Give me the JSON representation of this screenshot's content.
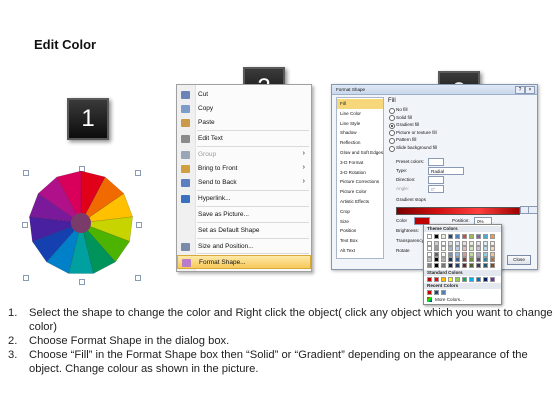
{
  "title": "Edit Color",
  "badges": [
    "1",
    "2",
    "3"
  ],
  "wheel": {
    "colors": [
      "#e0001a",
      "#f06a00",
      "#ffc000",
      "#c8d400",
      "#4cb400",
      "#00935a",
      "#00a0a0",
      "#0080c8",
      "#1440b0",
      "#4820a0",
      "#7a1a9a",
      "#b0108a",
      "#d8005a"
    ]
  },
  "context_menu": {
    "items": [
      {
        "label": "Cut",
        "icon": "scissors-icon",
        "color": "#6a84b8"
      },
      {
        "label": "Copy",
        "icon": "copy-icon",
        "color": "#7f9cc8"
      },
      {
        "label": "Paste",
        "icon": "paste-icon",
        "color": "#c89a4a"
      },
      {
        "label": "Edit Text",
        "icon": "edit-text-icon",
        "color": "#8a8a8a"
      },
      {
        "label": "Group",
        "icon": "group-icon",
        "color": "#9aa6b8"
      },
      {
        "label": "Bring to Front",
        "icon": "bring-to-front-icon",
        "color": "#d0a040"
      },
      {
        "label": "Send to Back",
        "icon": "send-to-back-icon",
        "color": "#5d7fc0"
      },
      {
        "label": "Hyperlink...",
        "icon": "hyperlink-icon",
        "color": "#3a70c0"
      },
      {
        "label": "Save as Picture...",
        "icon": "",
        "color": ""
      },
      {
        "label": "Set as Default Shape",
        "icon": "",
        "color": ""
      },
      {
        "label": "Size and Position...",
        "icon": "size-position-icon",
        "color": "#7a8aa8"
      },
      {
        "label": "Format Shape...",
        "icon": "format-shape-icon",
        "color": "#b87cc8"
      }
    ]
  },
  "dialog": {
    "title": "Format Shape",
    "nav": [
      "Fill",
      "Line Color",
      "Line Style",
      "Shadow",
      "Reflection",
      "Glow and Soft Edges",
      "3-D Format",
      "3-D Rotation",
      "Picture Corrections",
      "Picture Color",
      "Artistic Effects",
      "Crop",
      "Size",
      "Position",
      "Text Box",
      "Alt Text"
    ],
    "section": "Fill",
    "options": [
      "No fill",
      "Solid fill",
      "Gradient fill",
      "Picture or texture fill",
      "Pattern fill",
      "Slide background fill"
    ],
    "preset_label": "Preset colors:",
    "type_label": "Type:",
    "type_value": "Radial",
    "direction_label": "Direction:",
    "angle_label": "Angle:",
    "angle_value": "0°",
    "stops_label": "Gradient stops",
    "color_label": "Color",
    "position_label": "Position:",
    "position_value": "0%",
    "brightness_label": "Brightness:",
    "transparency_label": "Transparency:",
    "rotate_label": "Rotate",
    "close_label": "Close"
  },
  "palette": {
    "theme_label": "Theme Colors",
    "standard_label": "Standard Colors",
    "recent_label": "Recent Colors",
    "more_label": "More Colors...",
    "theme_top": [
      "#ffffff",
      "#000000",
      "#eeece1",
      "#1f497d",
      "#4f81bd",
      "#c0504d",
      "#9bbb59",
      "#8064a2",
      "#4bacc6",
      "#f79646"
    ],
    "standard": [
      "#c00000",
      "#ff0000",
      "#ffc000",
      "#ffff00",
      "#92d050",
      "#00b050",
      "#00b0f0",
      "#0070c0",
      "#002060",
      "#7030a0"
    ],
    "recent": [
      "#c00000",
      "#1f497d",
      "#4f81bd"
    ]
  },
  "steps": [
    {
      "num": "1.",
      "text": "Select the shape to change the color and Right click the object( click any object which you want to change color)"
    },
    {
      "num": "2.",
      "text": "Choose Format Shape in the dialog box."
    },
    {
      "num": "3.",
      "text": "Choose “Fill” in the Format Shape box then “Solid” or “Gradient” depending on the appearance of the object. Change colour as shown in the picture."
    }
  ]
}
